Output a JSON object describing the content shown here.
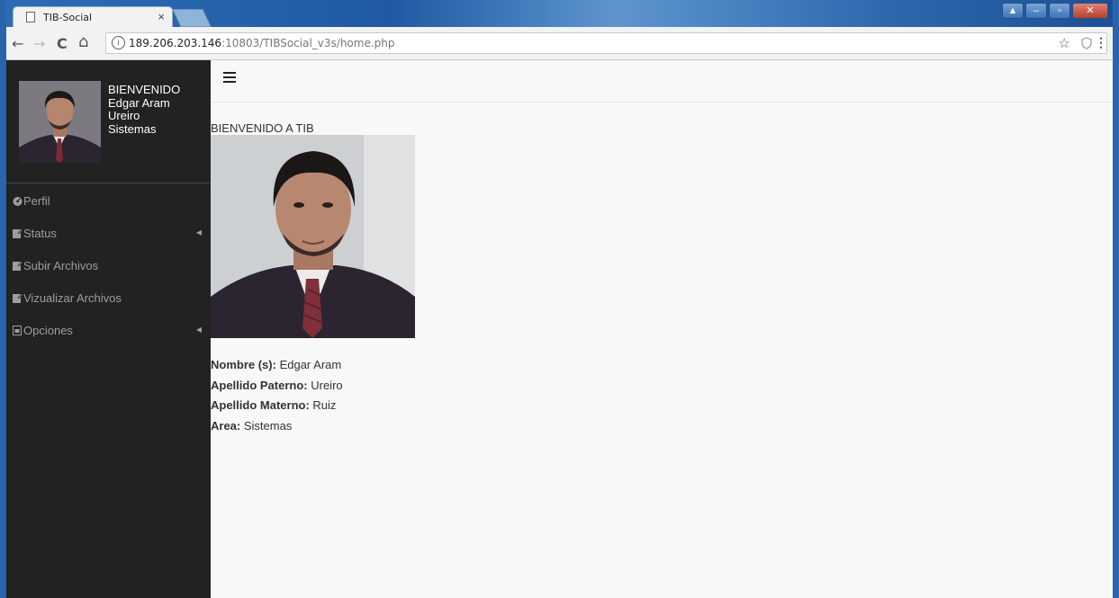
{
  "browser": {
    "tab_title": "TIB-Social",
    "tab_close": "×",
    "url_host": "189.206.203.146",
    "url_rest": ":10803/TIBSocial_v3s/home.php",
    "back": "←",
    "forward": "→",
    "reload": "C",
    "home": "⌂",
    "info": "i",
    "star": "☆",
    "menu": "⋮"
  },
  "sidebar": {
    "user": {
      "line1": "BIENVENIDO",
      "line2": "Edgar Aram",
      "line3": "Ureiro",
      "line4": "Sistemas"
    },
    "items": [
      {
        "label": "Perfil",
        "icon": "dashboard-icon",
        "has_caret": false
      },
      {
        "label": "Status",
        "icon": "edit-icon",
        "has_caret": true
      },
      {
        "label": "Subir Archivos",
        "icon": "edit-icon",
        "has_caret": false
      },
      {
        "label": "Vizualizar Archivos",
        "icon": "edit-icon",
        "has_caret": false
      },
      {
        "label": "Opciones",
        "icon": "file-icon",
        "has_caret": true
      }
    ],
    "caret": "◀"
  },
  "main": {
    "welcome": "BIENVENIDO A TIB",
    "details": [
      {
        "label": "Nombre (s):",
        "value": " Edgar Aram"
      },
      {
        "label": "Apellido Paterno:",
        "value": " Ureiro"
      },
      {
        "label": "Apellido Materno:",
        "value": " Ruiz"
      },
      {
        "label": "Area:",
        "value": " Sistemas"
      }
    ]
  },
  "colors": {
    "sidebar_bg": "#222222",
    "sidebar_text": "#9d9d9d",
    "content_bg": "#f8f8f8"
  }
}
